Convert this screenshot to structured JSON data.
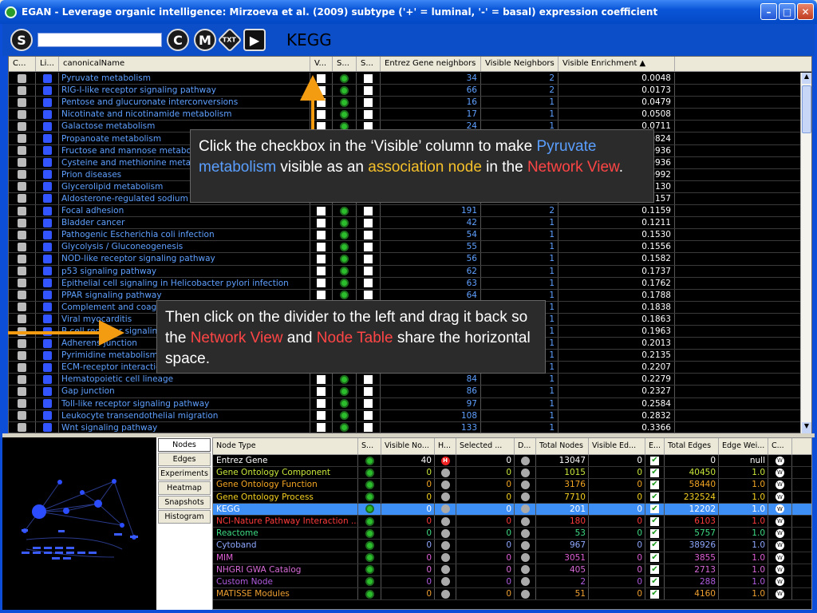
{
  "window": {
    "title": "EGAN - Leverage organic intelligence: Mirzoeva et al. (2009) subtype ('+' = luminal, '-' = basal) expression coefficient",
    "minimize": "–",
    "maximize": "□",
    "close": "✕"
  },
  "toolbar": {
    "s_label": "S",
    "c_label": "C",
    "m_label": "M",
    "txt_label": "TXT",
    "play_label": "▶",
    "search_value": "",
    "current_view": "KEGG"
  },
  "top_table": {
    "headers": [
      "C...",
      "Li...",
      "canonicalName",
      "V...",
      "S...",
      "S...",
      "Entrez Gene neighbors",
      "Visible Neighbors",
      "Visible Enrichment ▲"
    ],
    "rows": [
      {
        "name": "Pyruvate metabolism",
        "entrez": "34",
        "visible": "2",
        "enrich": "0.0048"
      },
      {
        "name": "RIG-I-like receptor signaling pathway",
        "entrez": "66",
        "visible": "2",
        "enrich": "0.0173"
      },
      {
        "name": "Pentose and glucuronate interconversions",
        "entrez": "16",
        "visible": "1",
        "enrich": "0.0479"
      },
      {
        "name": "Nicotinate and nicotinamide metabolism",
        "entrez": "17",
        "visible": "1",
        "enrich": "0.0508"
      },
      {
        "name": "Galactose metabolism",
        "entrez": "24",
        "visible": "1",
        "enrich": "0.0711"
      },
      {
        "name": "Propanoate metabolism",
        "entrez": "",
        "visible": "",
        "enrich": "0.0824"
      },
      {
        "name": "Fructose and mannose metabolism",
        "entrez": "",
        "visible": "",
        "enrich": "0.0936"
      },
      {
        "name": "Cysteine and methionine metabolism",
        "entrez": "",
        "visible": "",
        "enrich": "0.0936"
      },
      {
        "name": "Prion diseases",
        "entrez": "",
        "visible": "",
        "enrich": "0.0992"
      },
      {
        "name": "Glycerolipid metabolism",
        "entrez": "",
        "visible": "",
        "enrich": "0.1130"
      },
      {
        "name": "Aldosterone-regulated sodium reabsorption",
        "entrez": "",
        "visible": "",
        "enrich": "0.1157"
      },
      {
        "name": "Focal adhesion",
        "entrez": "191",
        "visible": "2",
        "enrich": "0.1159"
      },
      {
        "name": "Bladder cancer",
        "entrez": "42",
        "visible": "1",
        "enrich": "0.1211"
      },
      {
        "name": "Pathogenic Escherichia coli infection",
        "entrez": "54",
        "visible": "1",
        "enrich": "0.1530"
      },
      {
        "name": "Glycolysis / Gluconeogenesis",
        "entrez": "55",
        "visible": "1",
        "enrich": "0.1556"
      },
      {
        "name": "NOD-like receptor signaling pathway",
        "entrez": "56",
        "visible": "1",
        "enrich": "0.1582"
      },
      {
        "name": "p53 signaling pathway",
        "entrez": "62",
        "visible": "1",
        "enrich": "0.1737"
      },
      {
        "name": "Epithelial cell signaling in Helicobacter pylori infection",
        "entrez": "63",
        "visible": "1",
        "enrich": "0.1762"
      },
      {
        "name": "PPAR signaling pathway",
        "entrez": "64",
        "visible": "1",
        "enrich": "0.1788"
      },
      {
        "name": "Complement and coagulation cascades",
        "entrez": "",
        "visible": "1",
        "enrich": "0.1838"
      },
      {
        "name": "Viral myocarditis",
        "entrez": "",
        "visible": "1",
        "enrich": "0.1863"
      },
      {
        "name": "B cell receptor signaling pathway",
        "entrez": "",
        "visible": "1",
        "enrich": "0.1963"
      },
      {
        "name": "Adherens junction",
        "entrez": "",
        "visible": "1",
        "enrich": "0.2013"
      },
      {
        "name": "Pyrimidine metabolism",
        "entrez": "",
        "visible": "1",
        "enrich": "0.2135"
      },
      {
        "name": "ECM-receptor interaction",
        "entrez": "",
        "visible": "1",
        "enrich": "0.2207"
      },
      {
        "name": "Hematopoietic cell lineage",
        "entrez": "84",
        "visible": "1",
        "enrich": "0.2279"
      },
      {
        "name": "Gap junction",
        "entrez": "86",
        "visible": "1",
        "enrich": "0.2327"
      },
      {
        "name": "Toll-like receptor signaling pathway",
        "entrez": "97",
        "visible": "1",
        "enrich": "0.2584"
      },
      {
        "name": "Leukocyte transendothelial migration",
        "entrez": "108",
        "visible": "1",
        "enrich": "0.2832"
      },
      {
        "name": "Wnt signaling pathway",
        "entrez": "133",
        "visible": "1",
        "enrich": "0.3366"
      }
    ]
  },
  "side_tabs": [
    "Nodes",
    "Edges",
    "Experiments",
    "Heatmap",
    "Snapshots",
    "Histogram"
  ],
  "node_table": {
    "headers": [
      "Node Type",
      "S...",
      "Visible No...",
      "H...",
      "Selected ...",
      "D...",
      "Total Nodes",
      "Visible Ed...",
      "E...",
      "Total Edges",
      "Edge Wei...",
      "C..."
    ],
    "rows": [
      {
        "type": "Entrez Gene",
        "color": "#ffffff",
        "visible_nodes": "40",
        "hidden": true,
        "selected": "0",
        "total_nodes": "13047",
        "visible_edges": "0",
        "total_edges": "0",
        "edge_weight": "null"
      },
      {
        "type": "Gene Ontology Component",
        "color": "#c8e83a",
        "visible_nodes": "0",
        "hidden": false,
        "selected": "0",
        "total_nodes": "1015",
        "visible_edges": "0",
        "total_edges": "40450",
        "edge_weight": "1.0"
      },
      {
        "type": "Gene Ontology Function",
        "color": "#f5a623",
        "visible_nodes": "0",
        "hidden": false,
        "selected": "0",
        "total_nodes": "3176",
        "visible_edges": "0",
        "total_edges": "58440",
        "edge_weight": "1.0"
      },
      {
        "type": "Gene Ontology Process",
        "color": "#f5d020",
        "visible_nodes": "0",
        "hidden": false,
        "selected": "0",
        "total_nodes": "7710",
        "visible_edges": "0",
        "total_edges": "232524",
        "edge_weight": "1.0"
      },
      {
        "type": "KEGG",
        "color": "#ffffff",
        "visible_nodes": "0",
        "hidden": false,
        "selected": "0",
        "total_nodes": "201",
        "visible_edges": "0",
        "total_edges": "12202",
        "edge_weight": "1.0",
        "selected_row": true
      },
      {
        "type": "NCI-Nature Pathway Interaction ...",
        "color": "#ff3b3b",
        "visible_nodes": "0",
        "hidden": false,
        "selected": "0",
        "total_nodes": "180",
        "visible_edges": "0",
        "total_edges": "6103",
        "edge_weight": "1.0"
      },
      {
        "type": "Reactome",
        "color": "#3ddc84",
        "visible_nodes": "0",
        "hidden": false,
        "selected": "0",
        "total_nodes": "53",
        "visible_edges": "0",
        "total_edges": "5757",
        "edge_weight": "1.0"
      },
      {
        "type": "Cytoband",
        "color": "#8fa8ff",
        "visible_nodes": "0",
        "hidden": false,
        "selected": "0",
        "total_nodes": "967",
        "visible_edges": "0",
        "total_edges": "38926",
        "edge_weight": "1.0"
      },
      {
        "type": "MIM",
        "color": "#e05fd6",
        "visible_nodes": "0",
        "hidden": false,
        "selected": "0",
        "total_nodes": "3051",
        "visible_edges": "0",
        "total_edges": "3855",
        "edge_weight": "1.0"
      },
      {
        "type": "NHGRI GWA Catalog",
        "color": "#d86bd8",
        "visible_nodes": "0",
        "hidden": false,
        "selected": "0",
        "total_nodes": "405",
        "visible_edges": "0",
        "total_edges": "2713",
        "edge_weight": "1.0"
      },
      {
        "type": "Custom Node",
        "color": "#b05ce0",
        "visible_nodes": "0",
        "hidden": false,
        "selected": "0",
        "total_nodes": "2",
        "visible_edges": "0",
        "total_edges": "288",
        "edge_weight": "1.0"
      },
      {
        "type": "MATISSE Modules",
        "color": "#f0a030",
        "visible_nodes": "0",
        "hidden": false,
        "selected": "0",
        "total_nodes": "51",
        "visible_edges": "0",
        "total_edges": "4160",
        "edge_weight": "1.0"
      }
    ]
  },
  "callouts": {
    "first": {
      "p1": "Click the checkbox in the ‘Visible’ column to make ",
      "hl1": "Pyruvate metabolism",
      "p2": " visible as an ",
      "hl2": "association node",
      "p3": " in the ",
      "hl3": "Network View",
      "p4": "."
    },
    "second": {
      "p1": "Then click on the divider to the left and drag it back so the ",
      "hl1": "Network View",
      "p2": " and ",
      "hl2": "Node Table",
      "p3": " share the horizontal space."
    }
  },
  "colors": {
    "accent_blue": "#5a9fff",
    "accent_yellow": "#f5c02a",
    "accent_red": "#ff4545",
    "arrow_orange": "#f39c12"
  }
}
